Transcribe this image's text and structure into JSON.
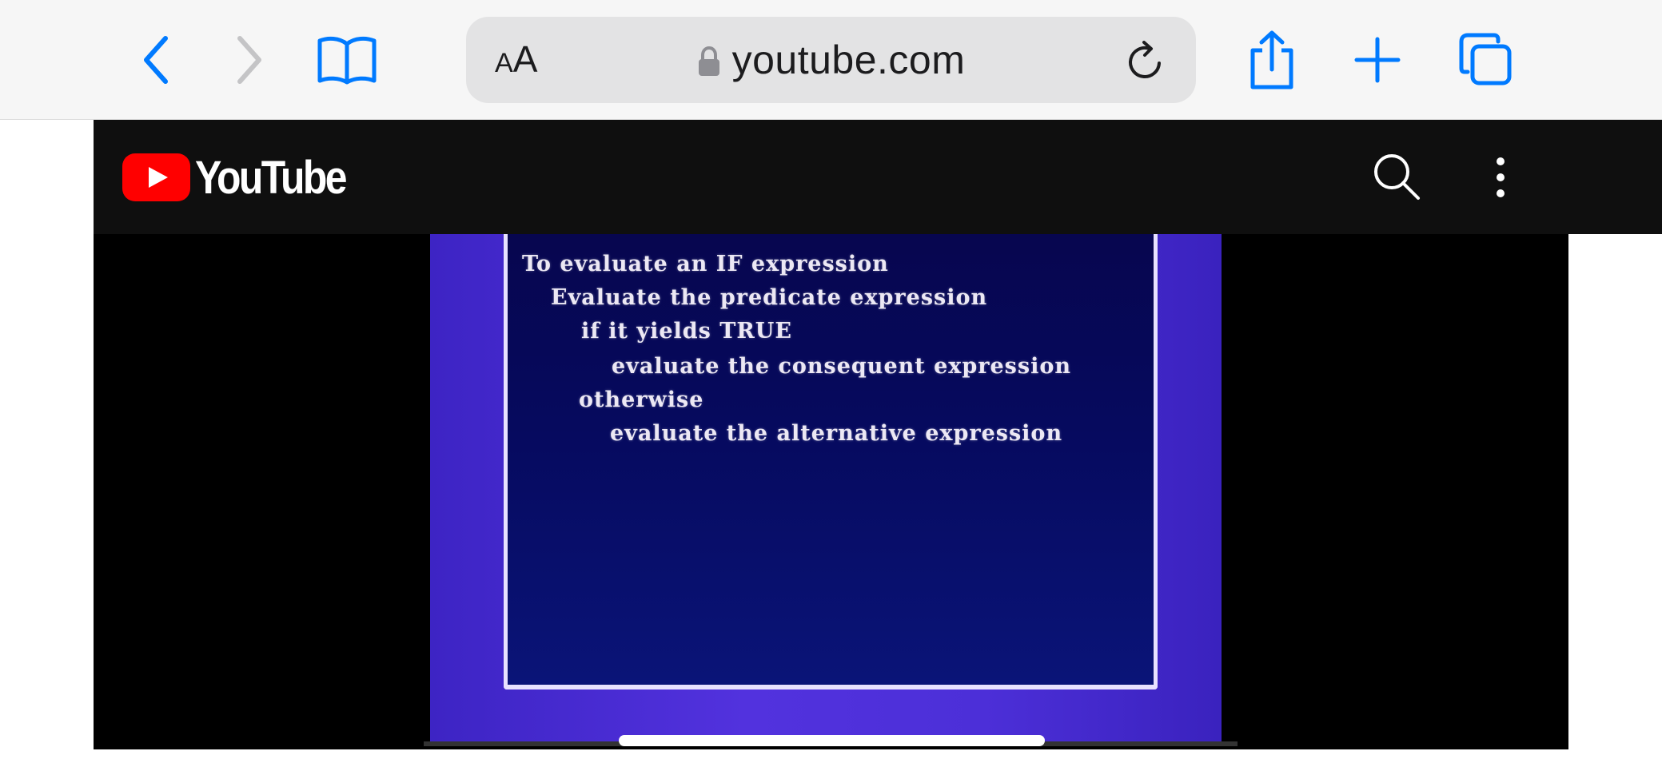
{
  "browser": {
    "back_icon": "chevron-left-icon",
    "forward_icon": "chevron-right-icon",
    "bookmarks_icon": "book-icon",
    "reader_label_small": "A",
    "reader_label_big": "A",
    "lock_icon": "lock-icon",
    "url": "youtube.com",
    "reload_icon": "reload-icon",
    "share_icon": "share-icon",
    "new_tab_icon": "plus-icon",
    "tabs_icon": "tabs-icon",
    "accent_color": "#007aff"
  },
  "youtube": {
    "logo_text": "YouTube",
    "logo_color": "#ff0000",
    "search_icon": "search-icon",
    "more_icon": "more-vertical-icon"
  },
  "video": {
    "lines": [
      "To evaluate an IF expression",
      "Evaluate the predicate expression",
      "if it yields TRUE",
      "evaluate the consequent expression",
      "otherwise",
      "evaluate the alternative expression"
    ]
  }
}
